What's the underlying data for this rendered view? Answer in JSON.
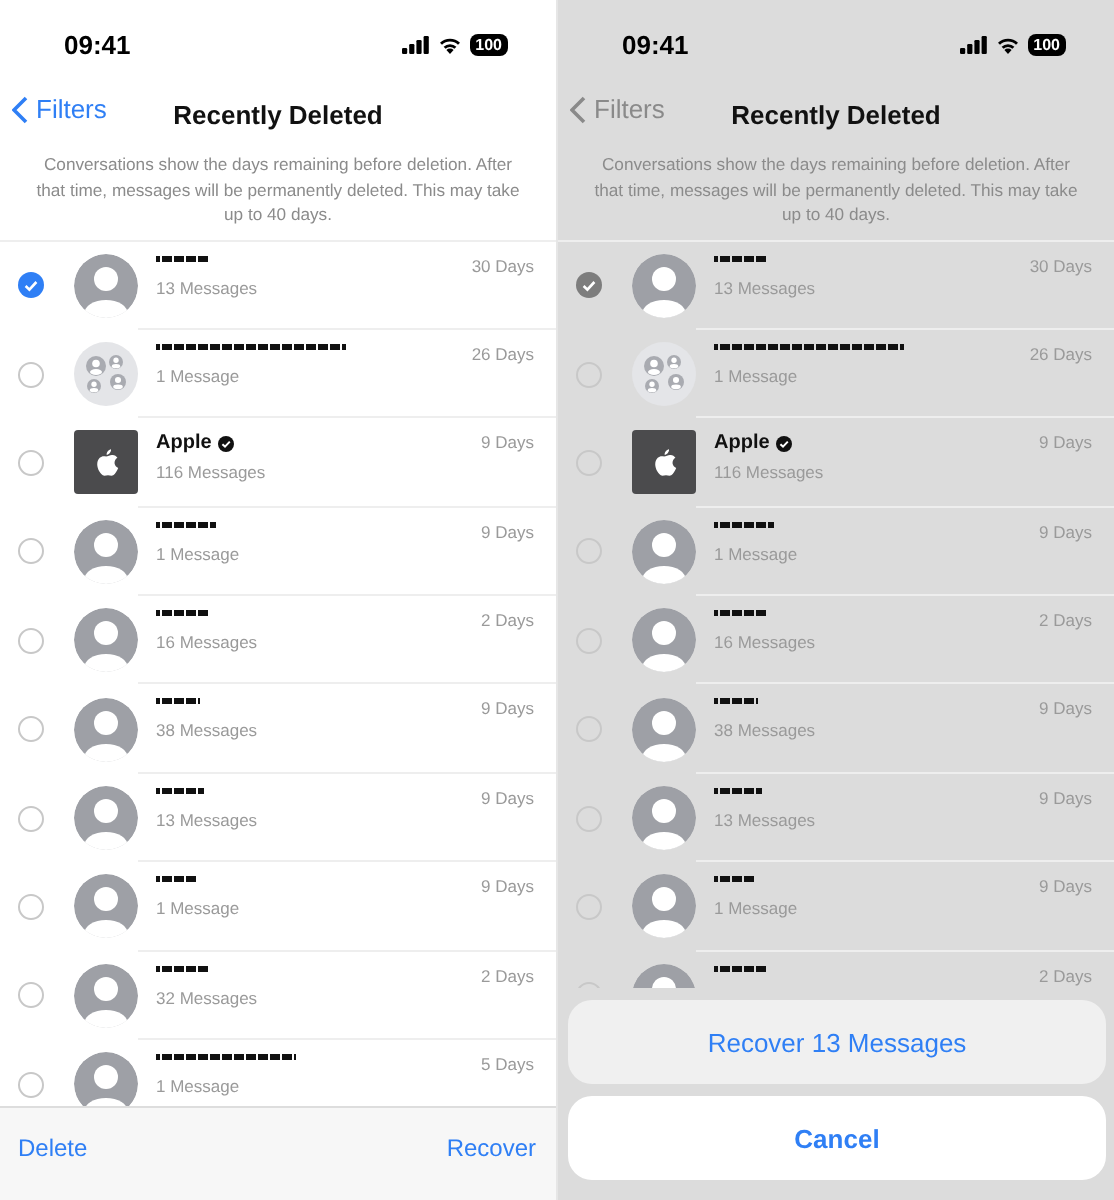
{
  "screens": [
    {
      "dimmed": false,
      "status_bar": {
        "time": "09:41",
        "battery": "100"
      },
      "nav": {
        "back": "Filters",
        "title": "Recently Deleted"
      },
      "note": "Conversations show the days remaining before deletion. After that time, messages will be permanently deleted. This may take up to 40 days.",
      "rows": [
        {
          "kind": "person",
          "redacted": true,
          "count": "13 Messages",
          "days": "30 Days",
          "selected": true
        },
        {
          "kind": "group",
          "redacted": true,
          "count": "1 Message",
          "days": "26 Days",
          "selected": false
        },
        {
          "kind": "apple",
          "name": "Apple",
          "verified": true,
          "count": "116 Messages",
          "days": "9 Days",
          "selected": false
        },
        {
          "kind": "person",
          "redacted": true,
          "count": "1 Message",
          "days": "9 Days",
          "selected": false
        },
        {
          "kind": "person",
          "redacted": true,
          "count": "16 Messages",
          "days": "2 Days",
          "selected": false
        },
        {
          "kind": "person",
          "redacted": true,
          "count": "38 Messages",
          "days": "9 Days",
          "selected": false
        },
        {
          "kind": "person",
          "redacted": true,
          "count": "13 Messages",
          "days": "9 Days",
          "selected": false
        },
        {
          "kind": "person",
          "redacted": true,
          "count": "1 Message",
          "days": "9 Days",
          "selected": false
        },
        {
          "kind": "person",
          "redacted": true,
          "count": "32 Messages",
          "days": "2 Days",
          "selected": false
        },
        {
          "kind": "person",
          "redacted": true,
          "count": "1 Message",
          "days": "5 Days",
          "selected": false
        }
      ],
      "toolbar": {
        "left": "Delete",
        "right": "Recover"
      }
    },
    {
      "dimmed": true,
      "status_bar": {
        "time": "09:41",
        "battery": "100"
      },
      "nav": {
        "back": "Filters",
        "title": "Recently Deleted"
      },
      "note": "Conversations show the days remaining before deletion. After that time, messages will be permanently deleted. This may take up to 40 days.",
      "rows": [
        {
          "kind": "person",
          "redacted": true,
          "count": "13 Messages",
          "days": "30 Days",
          "selected": true
        },
        {
          "kind": "group",
          "redacted": true,
          "count": "1 Message",
          "days": "26 Days",
          "selected": false
        },
        {
          "kind": "apple",
          "name": "Apple",
          "verified": true,
          "count": "116 Messages",
          "days": "9 Days",
          "selected": false
        },
        {
          "kind": "person",
          "redacted": true,
          "count": "1 Message",
          "days": "9 Days",
          "selected": false
        },
        {
          "kind": "person",
          "redacted": true,
          "count": "16 Messages",
          "days": "2 Days",
          "selected": false
        },
        {
          "kind": "person",
          "redacted": true,
          "count": "38 Messages",
          "days": "9 Days",
          "selected": false
        },
        {
          "kind": "person",
          "redacted": true,
          "count": "13 Messages",
          "days": "9 Days",
          "selected": false
        },
        {
          "kind": "person",
          "redacted": true,
          "count": "1 Message",
          "days": "9 Days",
          "selected": false
        },
        {
          "kind": "person",
          "redacted": true,
          "days": "2 Days",
          "selected": false
        }
      ],
      "action_sheet": {
        "action": "Recover 13 Messages",
        "cancel": "Cancel"
      }
    }
  ]
}
